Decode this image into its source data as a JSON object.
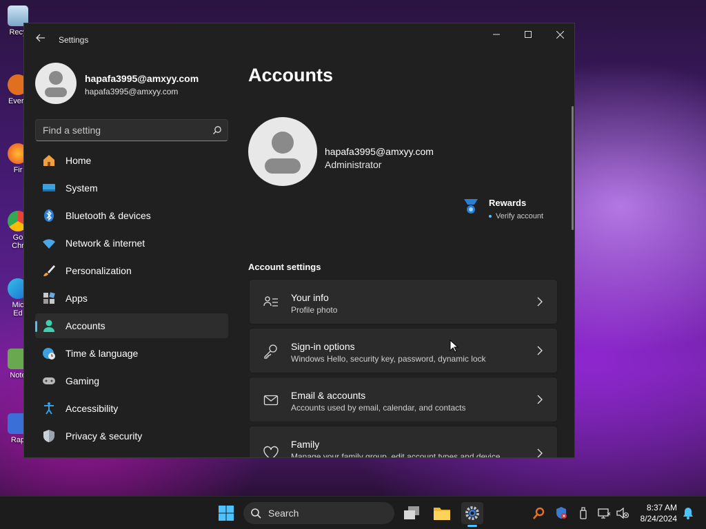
{
  "desktop": {
    "icons": [
      {
        "label": "Recy",
        "color": "#8fb8d8"
      },
      {
        "label": "Every",
        "color": "#e07020"
      },
      {
        "label": "Fir",
        "color": "#e84a2a"
      },
      {
        "label": "Go\nChr",
        "color": "#34a853"
      },
      {
        "label": "Mic\nEd",
        "color": "#2a7fd4"
      },
      {
        "label": "Note",
        "color": "#6aa84f"
      },
      {
        "label": "Rap",
        "color": "#3b6fd8"
      }
    ]
  },
  "window": {
    "title": "Settings"
  },
  "sidebar": {
    "user_name": "hapafa3995@amxyy.com",
    "user_email": "hapafa3995@amxyy.com",
    "search_placeholder": "Find a setting",
    "items": [
      {
        "label": "Home",
        "icon": "home-icon",
        "active": false
      },
      {
        "label": "System",
        "icon": "system-icon",
        "active": false
      },
      {
        "label": "Bluetooth & devices",
        "icon": "bluetooth-icon",
        "active": false
      },
      {
        "label": "Network & internet",
        "icon": "network-icon",
        "active": false
      },
      {
        "label": "Personalization",
        "icon": "brush-icon",
        "active": false
      },
      {
        "label": "Apps",
        "icon": "apps-icon",
        "active": false
      },
      {
        "label": "Accounts",
        "icon": "accounts-icon",
        "active": true
      },
      {
        "label": "Time & language",
        "icon": "globe-clock-icon",
        "active": false
      },
      {
        "label": "Gaming",
        "icon": "gamepad-icon",
        "active": false
      },
      {
        "label": "Accessibility",
        "icon": "accessibility-icon",
        "active": false
      },
      {
        "label": "Privacy & security",
        "icon": "shield-icon",
        "active": false
      }
    ]
  },
  "main": {
    "title": "Accounts",
    "account_email": "hapafa3995@amxyy.com",
    "account_role": "Administrator",
    "rewards_title": "Rewards",
    "rewards_sub": "Verify account",
    "section_title": "Account settings",
    "cards": [
      {
        "title": "Your info",
        "subtitle": "Profile photo",
        "icon": "person-list-icon"
      },
      {
        "title": "Sign-in options",
        "subtitle": "Windows Hello, security key, password, dynamic lock",
        "icon": "key-icon"
      },
      {
        "title": "Email & accounts",
        "subtitle": "Accounts used by email, calendar, and contacts",
        "icon": "mail-icon"
      },
      {
        "title": "Family",
        "subtitle": "Manage your family group, edit account types and device",
        "icon": "family-heart-icon"
      }
    ]
  },
  "taskbar": {
    "search_label": "Search",
    "time": "8:37 AM",
    "date": "8/24/2024"
  },
  "colors": {
    "accent": "#4cc2ff",
    "window_bg": "#202020",
    "card_bg": "#2b2b2b"
  }
}
